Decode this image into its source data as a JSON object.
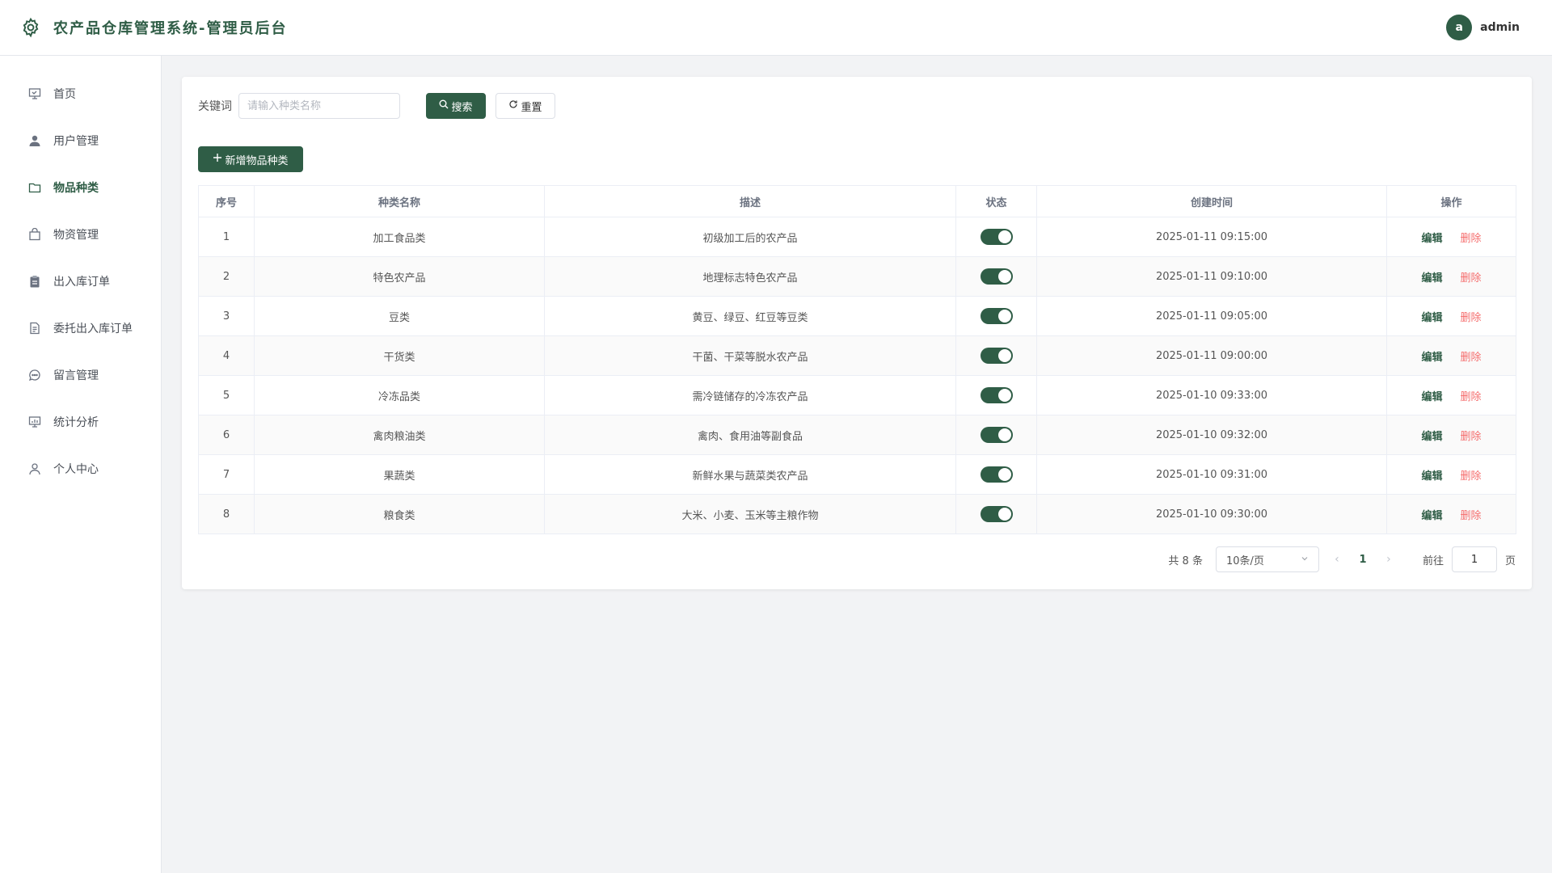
{
  "header": {
    "title": "农产品仓库管理系统-管理员后台",
    "avatar_letter": "a",
    "username": "admin"
  },
  "sidebar": {
    "items": [
      {
        "label": "首页",
        "icon": "presentation-icon",
        "active": false
      },
      {
        "label": "用户管理",
        "icon": "user-icon",
        "active": false
      },
      {
        "label": "物品种类",
        "icon": "folder-icon",
        "active": true
      },
      {
        "label": "物资管理",
        "icon": "shopping-bag-icon",
        "active": false
      },
      {
        "label": "出入库订单",
        "icon": "clipboard-icon",
        "active": false
      },
      {
        "label": "委托出入库订单",
        "icon": "document-icon",
        "active": false
      },
      {
        "label": "留言管理",
        "icon": "chat-icon",
        "active": false
      },
      {
        "label": "统计分析",
        "icon": "chart-board-icon",
        "active": false
      },
      {
        "label": "个人中心",
        "icon": "user-outline-icon",
        "active": false
      }
    ]
  },
  "search": {
    "label": "关键词",
    "placeholder": "请输入种类名称",
    "value": "",
    "search_button": "搜索",
    "reset_button": "重置"
  },
  "toolbar": {
    "add_button": "新增物品种类"
  },
  "table": {
    "columns": [
      "序号",
      "种类名称",
      "描述",
      "状态",
      "创建时间",
      "操作"
    ],
    "rows": [
      {
        "index": "1",
        "name": "加工食品类",
        "desc": "初级加工后的农产品",
        "enabled": true,
        "created": "2025-01-11 09:15:00"
      },
      {
        "index": "2",
        "name": "特色农产品",
        "desc": "地理标志特色农产品",
        "enabled": true,
        "created": "2025-01-11 09:10:00"
      },
      {
        "index": "3",
        "name": "豆类",
        "desc": "黄豆、绿豆、红豆等豆类",
        "enabled": true,
        "created": "2025-01-11 09:05:00"
      },
      {
        "index": "4",
        "name": "干货类",
        "desc": "干菌、干菜等脱水农产品",
        "enabled": true,
        "created": "2025-01-11 09:00:00"
      },
      {
        "index": "5",
        "name": "冷冻品类",
        "desc": "需冷链储存的冷冻农产品",
        "enabled": true,
        "created": "2025-01-10 09:33:00"
      },
      {
        "index": "6",
        "name": "禽肉粮油类",
        "desc": "禽肉、食用油等副食品",
        "enabled": true,
        "created": "2025-01-10 09:32:00"
      },
      {
        "index": "7",
        "name": "果蔬类",
        "desc": "新鲜水果与蔬菜类农产品",
        "enabled": true,
        "created": "2025-01-10 09:31:00"
      },
      {
        "index": "8",
        "name": "粮食类",
        "desc": "大米、小麦、玉米等主粮作物",
        "enabled": true,
        "created": "2025-01-10 09:30:00"
      }
    ],
    "edit_label": "编辑",
    "delete_label": "删除"
  },
  "pagination": {
    "total_text": "共 8 条",
    "page_size": "10条/页",
    "current_page": "1",
    "goto_label": "前往",
    "goto_value": "1",
    "page_unit": "页"
  },
  "colors": {
    "primary": "#2f5d46",
    "danger": "#f56c6c"
  }
}
